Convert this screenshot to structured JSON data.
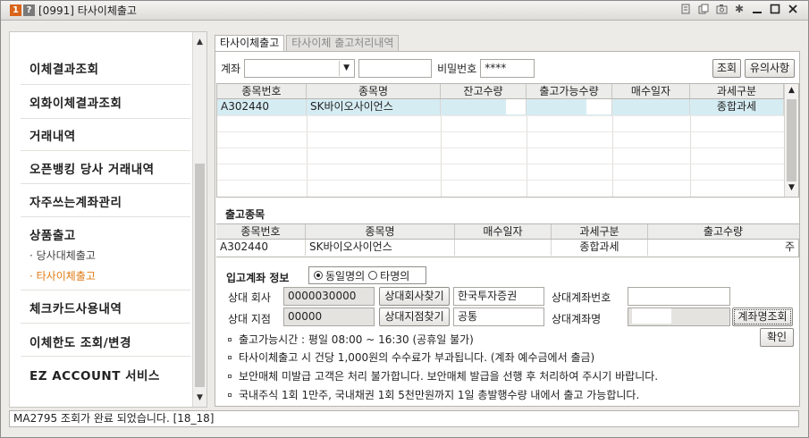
{
  "window": {
    "badge1": "1",
    "badge2": "?",
    "title": "[0991] 타사이체출고",
    "badge1_color": "#d9641a",
    "badge2_color": "#777777"
  },
  "titlebar_icons": [
    "note-icon",
    "copy-icon",
    "camera-icon",
    "gear-icon",
    "minimize-icon",
    "maximize-icon",
    "close-icon"
  ],
  "sidebar": {
    "items": [
      {
        "label": "이체결과조회"
      },
      {
        "label": "외화이체결과조회"
      },
      {
        "label": "거래내역"
      },
      {
        "label": "오픈뱅킹 당사 거래내역"
      },
      {
        "label": "자주쓰는계좌관리"
      },
      {
        "label": "상품출고"
      },
      {
        "label": "체크카드사용내역"
      },
      {
        "label": "이체한도 조회/변경"
      },
      {
        "label": "EZ ACCOUNT 서비스"
      }
    ],
    "subitems": [
      {
        "label": "· 당사대체출고"
      },
      {
        "label": "· 타사이체출고"
      }
    ],
    "active_color": "#e07b16"
  },
  "tabs": [
    {
      "label": "타사이체출고"
    },
    {
      "label": "타사이체 출고처리내역"
    }
  ],
  "account": {
    "label": "계좌",
    "password_label": "비밀번호",
    "password_value": "****",
    "query_button": "조회",
    "notice_button": "유의사항"
  },
  "holdings_table": {
    "headers": [
      "종목번호",
      "종목명",
      "잔고수량",
      "출고가능수량",
      "매수일자",
      "과세구분"
    ],
    "rows": [
      {
        "code": "A302440",
        "name": "SK바이오사이언스",
        "balance": "",
        "available": "",
        "buy_date": "",
        "tax": "종합과세"
      }
    ],
    "selected_color": "#d6ecf3"
  },
  "outgoing": {
    "title": "출고종목",
    "headers": [
      "종목번호",
      "종목명",
      "매수일자",
      "과세구분",
      "출고수량"
    ],
    "row": {
      "code": "A302440",
      "name": "SK바이오사이언스",
      "buy_date": "",
      "tax": "종합과세",
      "qty_unit": "주"
    }
  },
  "deposit": {
    "title": "입고계좌 정보",
    "radio_same": "동일명의",
    "radio_other": "타명의",
    "firm_label": "상대 회사",
    "firm_code": "0000030000",
    "firm_button": "상대회사찾기",
    "firm_name": "한국투자증권",
    "branch_label": "상대 지점",
    "branch_code": "00000",
    "branch_button": "상대지점찾기",
    "branch_name": "공통",
    "acct_no_label": "상대계좌번호",
    "acct_name_label": "상대계좌명",
    "acct_name_button": "계좌명조회",
    "confirm_button": "확인"
  },
  "notes": [
    "출고가능시간 : 평일 08:00 ~ 16:30 (공휴일 불가)",
    "타사이체출고 시 건당 1,000원의 수수료가 부과됩니다. (계좌 예수금에서 출금)",
    "보안매체 미발급 고객은 처리 불가합니다. 보안매체 발급을 선행 후 처리하여 주시기 바랍니다.",
    "국내주식 1회 1만주, 국내채권 1회 5천만원까지 1일 총발행수량 내에서 출고 가능합니다."
  ],
  "status": {
    "message": "MA2795 조회가 완료 되었습니다. [18_18]"
  }
}
